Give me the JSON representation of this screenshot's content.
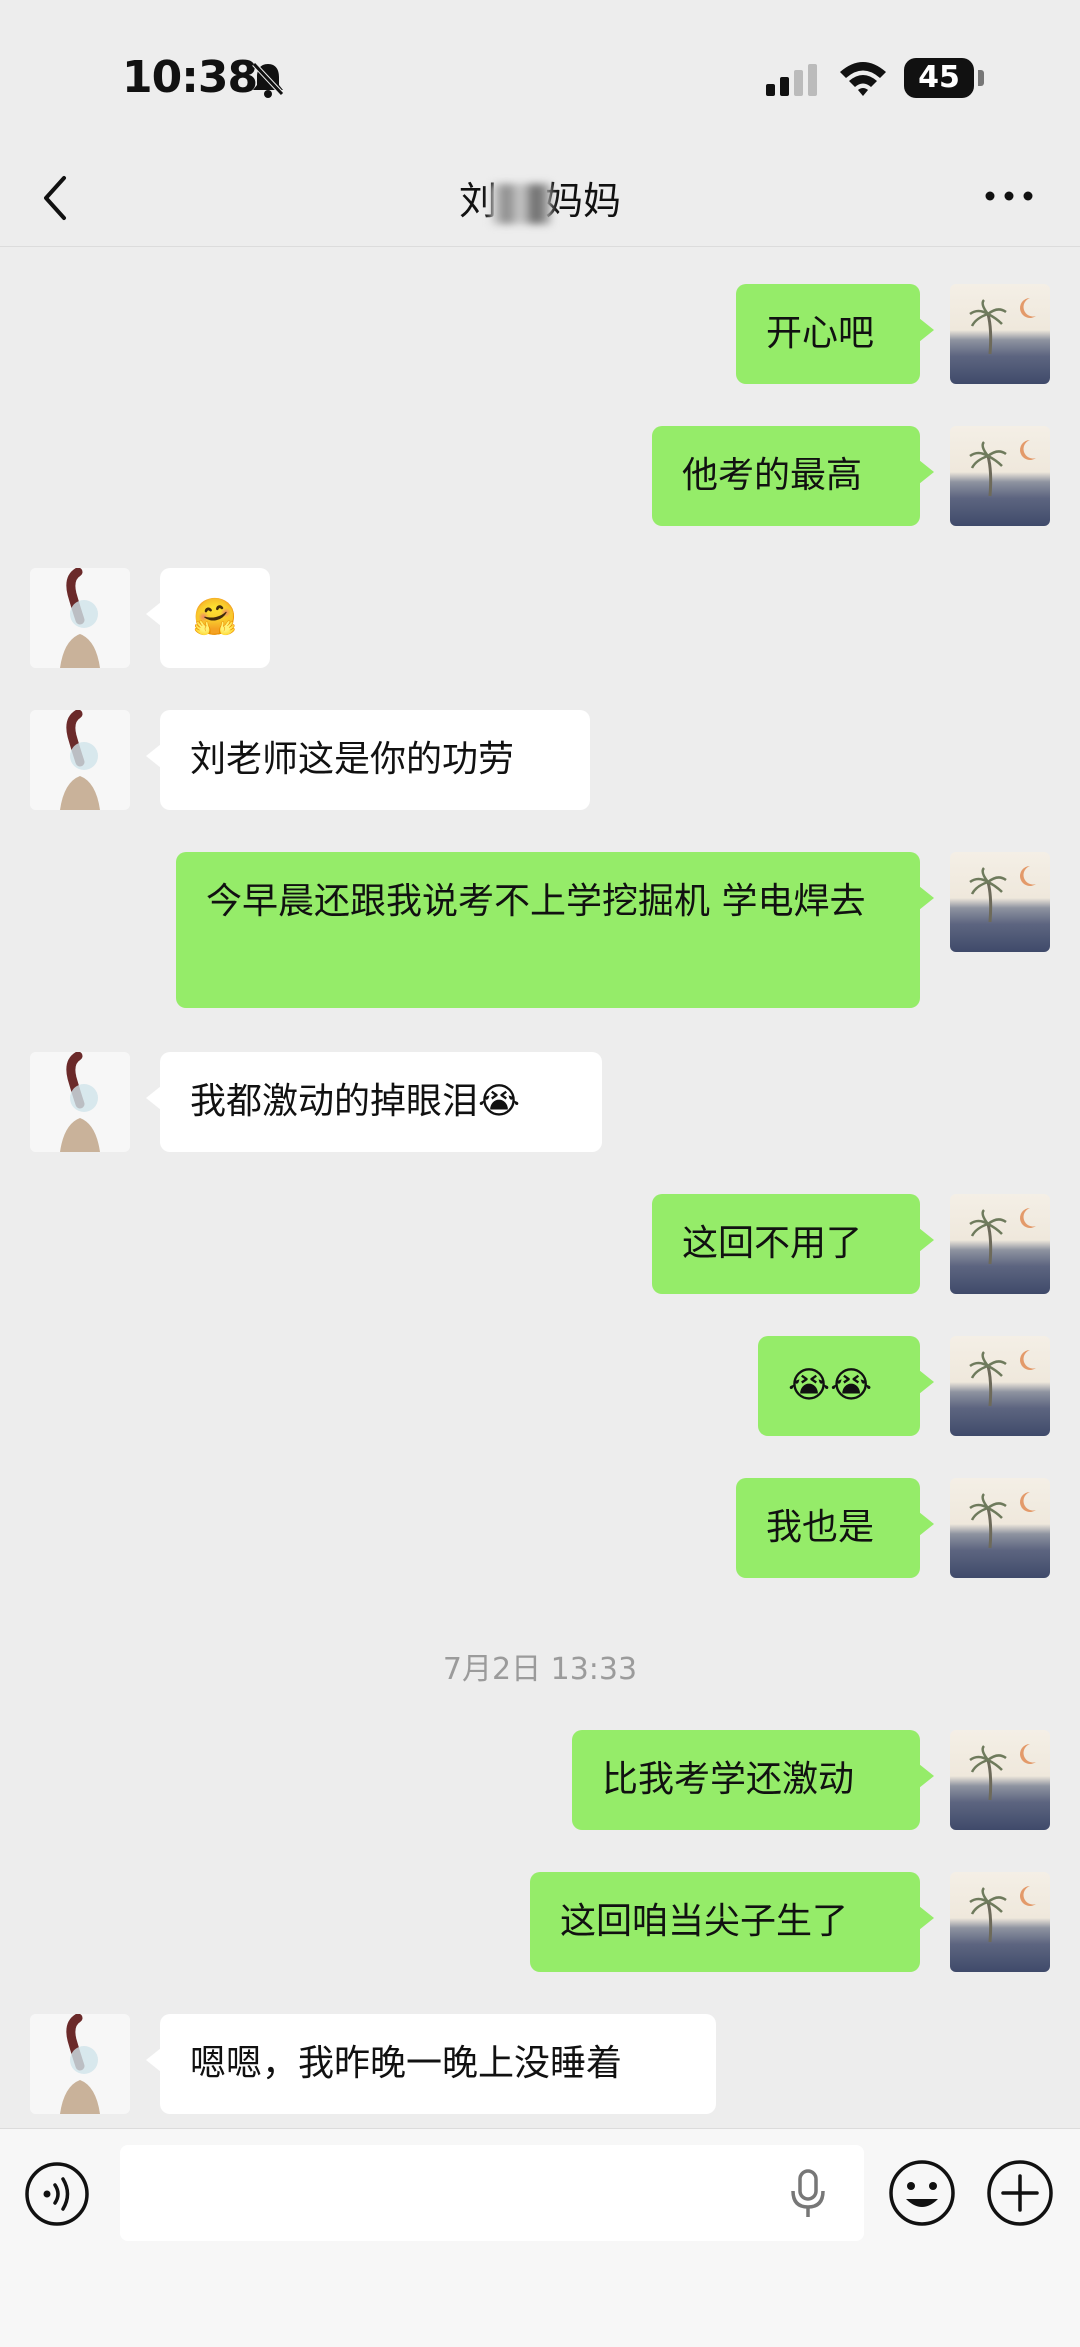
{
  "status_bar": {
    "time": "10:38",
    "battery": "45"
  },
  "header": {
    "title_prefix": "刘",
    "title_suffix": "妈妈"
  },
  "messages": [
    {
      "text": "开心吧"
    },
    {
      "text": "他考的最高"
    },
    {
      "text": "🤗"
    },
    {
      "text": "刘老师这是你的功劳"
    },
    {
      "text": "今早晨还跟我说考不上学挖掘机  学电焊去"
    },
    {
      "text": "我都激动的掉眼泪😭"
    },
    {
      "text": "这回不用了"
    },
    {
      "text": "😭😭"
    },
    {
      "text": "我也是"
    },
    {
      "text": "比我考学还激动"
    },
    {
      "text": "这回咱当尖子生了"
    },
    {
      "text": "嗯嗯，我昨晚一晚上没睡着"
    }
  ],
  "timestamp": "7月2日 13:33",
  "colors": {
    "my_bubble": "#95ec69",
    "other_bubble": "#ffffff",
    "background": "#ededed"
  },
  "icons": [
    "back-chevron-icon",
    "more-icon",
    "voice-icon",
    "microphone-icon",
    "emoji-icon",
    "plus-icon",
    "bell-muted-icon",
    "signal-icon",
    "wifi-icon",
    "battery-icon"
  ]
}
